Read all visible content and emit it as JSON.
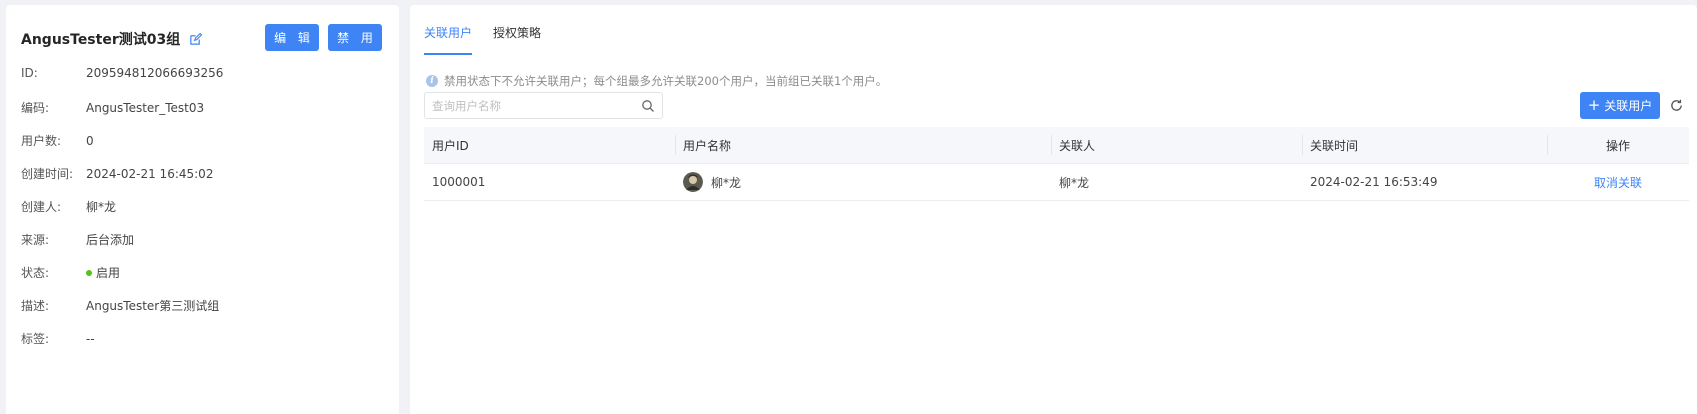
{
  "group": {
    "title": "AngusTester测试03组",
    "edit_label": "编 辑",
    "disable_label": "禁 用"
  },
  "info": [
    {
      "label": "ID:",
      "value": "209594812066693256"
    },
    {
      "label": "编码:",
      "value": "AngusTester_Test03"
    },
    {
      "label": "用户数:",
      "value": "0"
    },
    {
      "label": "创建时间:",
      "value": "2024-02-21 16:45:02"
    },
    {
      "label": "创建人:",
      "value": "柳*龙"
    },
    {
      "label": "来源:",
      "value": "后台添加"
    },
    {
      "label": "状态:",
      "value": "启用"
    },
    {
      "label": "描述:",
      "value": "AngusTester第三测试组"
    },
    {
      "label": "标签:",
      "value": "--"
    }
  ],
  "tabs": [
    {
      "label": "关联用户",
      "active": true
    },
    {
      "label": "授权策略",
      "active": false
    }
  ],
  "hint": "禁用状态下不允许关联用户；每个组最多允许关联200个用户，当前组已关联1个用户。",
  "search": {
    "placeholder": "查询用户名称",
    "value": ""
  },
  "add_button": "关联用户",
  "table": {
    "headers": [
      "用户ID",
      "用户名称",
      "关联人",
      "关联时间",
      "操作"
    ],
    "rows": [
      {
        "user_id": "1000001",
        "user_name": "柳*龙",
        "associated_by": "柳*龙",
        "time": "2024-02-21 16:53:49",
        "action": "取消关联"
      }
    ]
  },
  "colors": {
    "primary": "#3e84f5",
    "status_active": "#52c41a"
  }
}
